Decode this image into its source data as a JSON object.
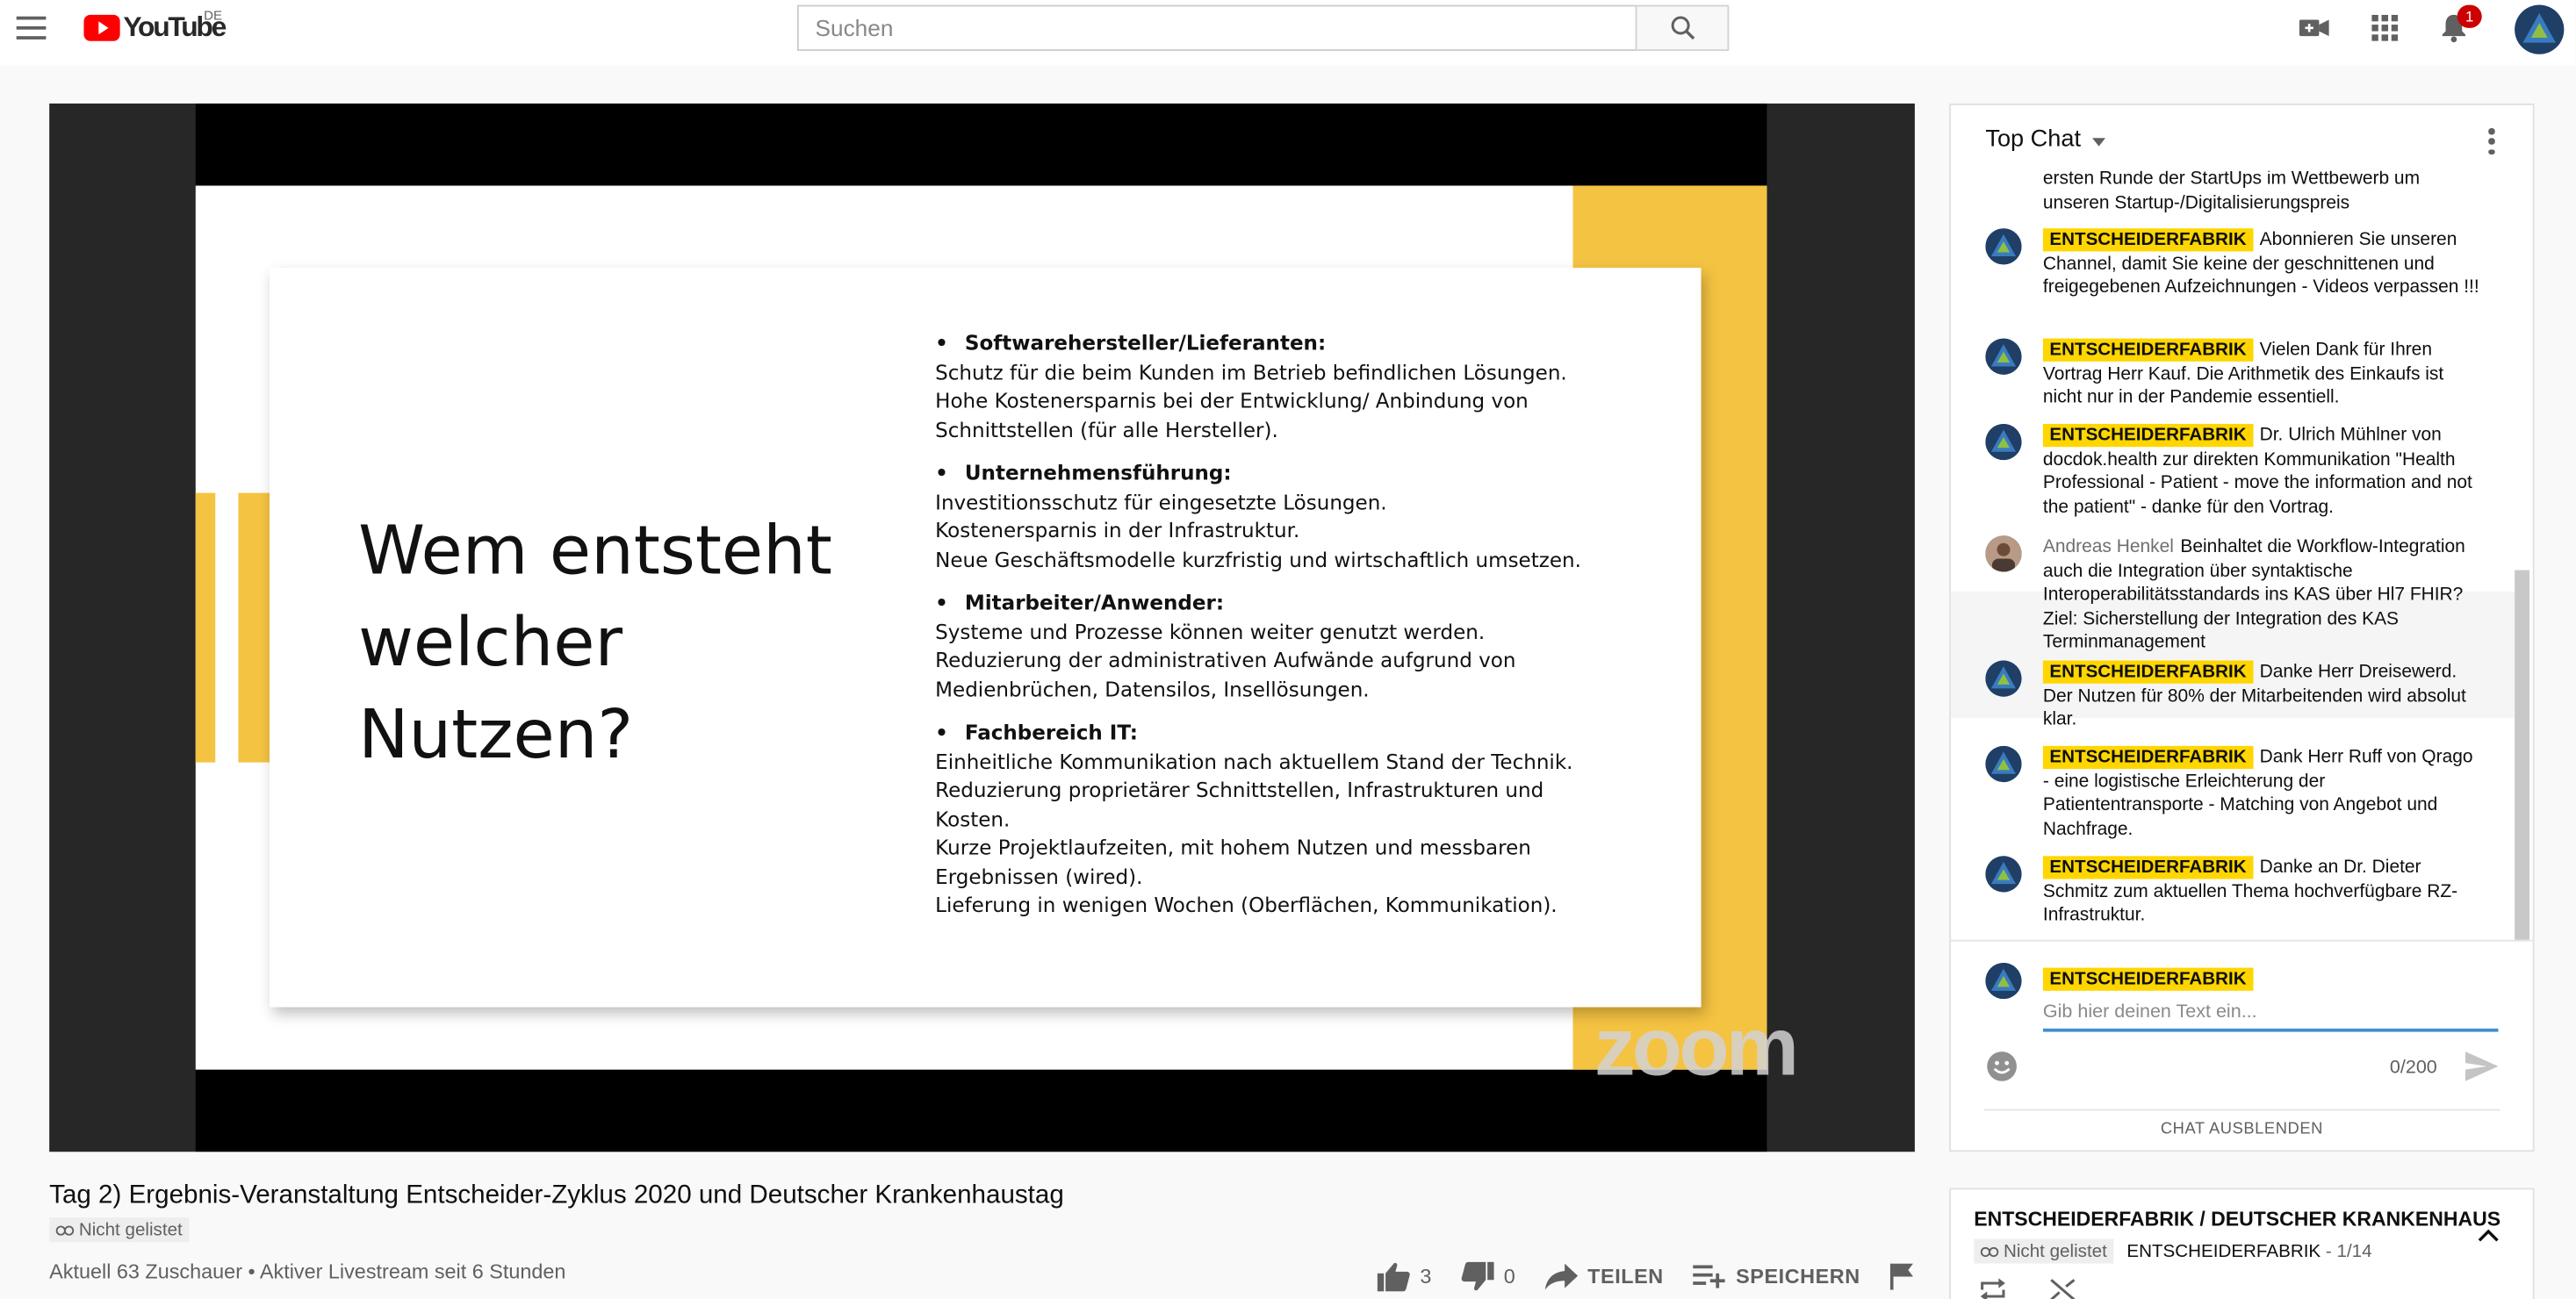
{
  "masthead": {
    "logo_text": "YouTube",
    "country_code": "DE",
    "search_placeholder": "Suchen",
    "notification_count": "1"
  },
  "slide": {
    "title": "Wem entsteht\nwelcher\nNutzen?",
    "items": [
      {
        "heading": "Softwarehersteller/Lieferanten:",
        "lines": [
          "Schutz für die beim Kunden im Betrieb befindlichen Lösungen.",
          "Hohe Kostenersparnis bei der Entwicklung/ Anbindung von",
          "Schnittstellen (für alle Hersteller)."
        ]
      },
      {
        "heading": "Unternehmensführung:",
        "lines": [
          "Investitionsschutz für eingesetzte Lösungen.",
          "Kostenersparnis in der Infrastruktur.",
          "Neue Geschäftsmodelle kurzfristig und wirtschaftlich umsetzen."
        ]
      },
      {
        "heading": "Mitarbeiter/Anwender:",
        "lines": [
          "Systeme und Prozesse können weiter genutzt werden.",
          "Reduzierung der administrativen Aufwände aufgrund von",
          "Medienbrüchen, Datensilos, Insellösungen."
        ]
      },
      {
        "heading": "Fachbereich IT:",
        "lines": [
          "Einheitliche Kommunikation nach aktuellem Stand der Technik.",
          "Reduzierung proprietärer Schnittstellen, Infrastrukturen und",
          "Kosten.",
          "Kurze Projektlaufzeiten, mit hohem Nutzen und messbaren",
          "Ergebnissen (wired).",
          "Lieferung in wenigen Wochen (Oberflächen, Kommunikation)."
        ]
      }
    ],
    "watermark": "zoom"
  },
  "video": {
    "title": "Tag 2) Ergebnis-Veranstaltung Entscheider-Zyklus 2020 und Deutscher Krankenhaustag",
    "unlisted": "Nicht gelistet",
    "view_info": "Aktuell 63 Zuschauer • Aktiver Livestream seit 6 Stunden",
    "likes": "3",
    "dislikes": "0",
    "share_label": "TEILEN",
    "save_label": "SPEICHERN"
  },
  "chat": {
    "header": "Top Chat",
    "partial_message": "ersten Runde der StartUps im Wettbewerb um unseren Startup-/Digitalisierungspreis",
    "messages": [
      {
        "author": "ENTSCHEIDERFABRIK",
        "text": "Abonnieren Sie unseren Channel, damit Sie keine der geschnittenen und freigegebenen Aufzeichnungen - Videos verpassen !!!"
      },
      {
        "author": "ENTSCHEIDERFABRIK",
        "text": "Vielen Dank für Ihren Vortrag Herr Kauf. Die Arithmetik des Einkaufs ist nicht nur in der Pandemie essentiell."
      },
      {
        "author": "ENTSCHEIDERFABRIK",
        "text": "Dr. Ulrich Mühlner von docdok.health zur direkten Kommunikation \"Health Professional - Patient - move the information and not the patient\" - danke für den Vortrag."
      },
      {
        "author": "Andreas Henkel",
        "text": "Beinhaltet die Workflow-Integration auch die Integration über syntaktische Interoperabilitätsstandards ins KAS über Hl7 FHIR? Ziel: Sicherstellung der Integration des KAS Terminmanagement"
      },
      {
        "author": "ENTSCHEIDERFABRIK",
        "text": "Danke Herr Dreisewerd. Der Nutzen für 80% der Mitarbeitenden wird absolut klar."
      },
      {
        "author": "ENTSCHEIDERFABRIK",
        "text": "Dank Herr Ruff von Qrago - eine logistische Erleichterung der Patiententransporte - Matching von Angebot und Nachfrage."
      },
      {
        "author": "ENTSCHEIDERFABRIK",
        "text": "Danke an Dr. Dieter Schmitz zum aktuellen Thema hochverfügbare RZ-Infrastruktur."
      }
    ],
    "compose_author": "ENTSCHEIDERFABRIK",
    "input_placeholder": "Gib hier deinen Text ein...",
    "char_count": "0/200",
    "hide_chat_label": "CHAT AUSBLENDEN"
  },
  "playlist": {
    "title": "ENTSCHEIDERFABRIK / DEUTSCHER KRANKENHAUS",
    "unlisted": "Nicht gelistet",
    "owner": "ENTSCHEIDERFABRIK",
    "position": "- 1/14"
  },
  "colors": {
    "youtube_red": "#ff0000",
    "badge_yellow": "#ffd600",
    "slide_accent": "#f5c342",
    "notification_red": "#cc0000"
  }
}
